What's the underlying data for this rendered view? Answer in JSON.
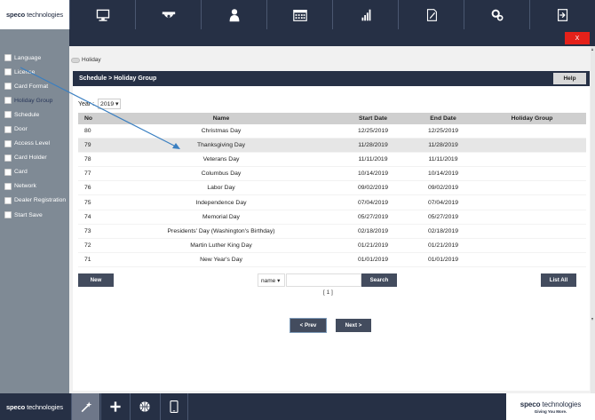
{
  "brand": {
    "logo_left_bold": "speco",
    "logo_left_light": " technologies",
    "logo_right_bold": "speco",
    "logo_right_light": " technologies",
    "tagline": "Giving You More."
  },
  "top_nav": [
    {
      "icon": "monitor-icon"
    },
    {
      "icon": "dome-camera-icon"
    },
    {
      "icon": "user-icon"
    },
    {
      "icon": "calendar-icon"
    },
    {
      "icon": "signal-bars-icon"
    },
    {
      "icon": "edit-document-icon"
    },
    {
      "icon": "gears-icon"
    },
    {
      "icon": "logout-icon"
    }
  ],
  "sidebar": {
    "items": [
      {
        "label": "Language"
      },
      {
        "label": "License"
      },
      {
        "label": "Card Format"
      },
      {
        "label": "Holiday Group"
      },
      {
        "label": "Schedule"
      },
      {
        "label": "Door"
      },
      {
        "label": "Access Level"
      },
      {
        "label": "Card Holder"
      },
      {
        "label": "Card"
      },
      {
        "label": "Network"
      },
      {
        "label": "Dealer Registration"
      },
      {
        "label": "Start Save"
      }
    ]
  },
  "close_label": "X",
  "breadcrumb_top": "Holiday",
  "panel": {
    "title": "Schedule > Holiday Group",
    "help_label": "Help"
  },
  "year": {
    "label": "Year :",
    "value": "2019 ▾"
  },
  "table": {
    "headers": [
      "No",
      "Name",
      "Start Date",
      "End Date",
      "Holiday Group"
    ],
    "rows": [
      {
        "no": "80",
        "name": "Christmas Day",
        "start": "12/25/2019",
        "end": "12/25/2019",
        "group": ""
      },
      {
        "no": "79",
        "name": "Thanksgiving Day",
        "start": "11/28/2019",
        "end": "11/28/2019",
        "group": ""
      },
      {
        "no": "78",
        "name": "Veterans Day",
        "start": "11/11/2019",
        "end": "11/11/2019",
        "group": ""
      },
      {
        "no": "77",
        "name": "Columbus Day",
        "start": "10/14/2019",
        "end": "10/14/2019",
        "group": ""
      },
      {
        "no": "76",
        "name": "Labor Day",
        "start": "09/02/2019",
        "end": "09/02/2019",
        "group": ""
      },
      {
        "no": "75",
        "name": "Independence Day",
        "start": "07/04/2019",
        "end": "07/04/2019",
        "group": ""
      },
      {
        "no": "74",
        "name": "Memorial Day",
        "start": "05/27/2019",
        "end": "05/27/2019",
        "group": ""
      },
      {
        "no": "73",
        "name": "Presidents' Day (Washington's Birthday)",
        "start": "02/18/2019",
        "end": "02/18/2019",
        "group": ""
      },
      {
        "no": "72",
        "name": "Martin Luther King Day",
        "start": "01/21/2019",
        "end": "01/21/2019",
        "group": ""
      },
      {
        "no": "71",
        "name": "New Year's Day",
        "start": "01/01/2019",
        "end": "01/01/2019",
        "group": ""
      }
    ]
  },
  "actions": {
    "new_label": "New",
    "field_select": "name ▾",
    "search_value": "",
    "search_label": "Search",
    "list_all_label": "List All",
    "pager": "[ 1 ]",
    "prev_label": "< Prev",
    "next_label": "Next >"
  },
  "bottom_bar": [
    {
      "icon": "magic-wand-icon"
    },
    {
      "icon": "plus-icon"
    },
    {
      "icon": "basketball-icon"
    },
    {
      "icon": "tablet-icon"
    }
  ],
  "colors": {
    "navy": "#263045",
    "sidebar_gray": "#7f8a95",
    "close_red": "#e5211a",
    "button_dark": "#434c5e",
    "row_highlight": "#e6e6e6",
    "annotation_arrow": "#3a7fc1"
  }
}
